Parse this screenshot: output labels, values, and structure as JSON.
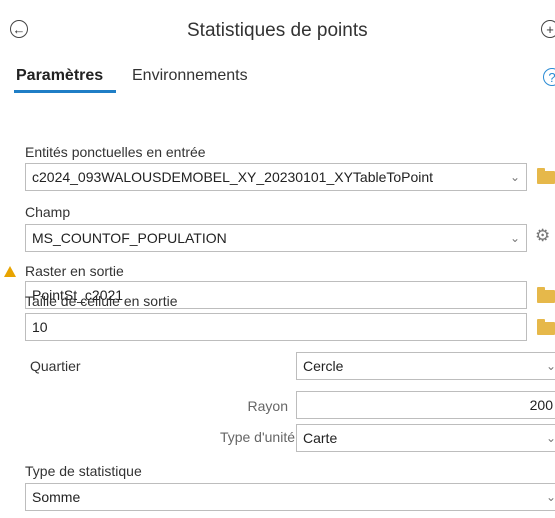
{
  "header": {
    "title": "Statistiques de points",
    "back_icon": "back-arrow-circle-icon",
    "add_icon": "plus-circle-icon"
  },
  "tabs": [
    {
      "label": "Paramètres",
      "active": true
    },
    {
      "label": "Environnements",
      "active": false
    }
  ],
  "help_icon": "help-circle-icon",
  "params": {
    "input_features": {
      "label": "Entités ponctuelles en entrée",
      "value": "c2024_093WALOUSDEMOBEL_XY_20230101_XYTableToPoint"
    },
    "field": {
      "label": "Champ",
      "value": "MS_COUNTOF_POPULATION"
    },
    "output_raster": {
      "label": "Raster en sortie",
      "value": "PointSt_c2021",
      "warning_icon": "warning-icon"
    },
    "cell_size": {
      "label": "Taille de cellule en sortie",
      "value": "10"
    },
    "neighborhood": {
      "label": "Quartier",
      "value": "Cercle"
    },
    "radius": {
      "label": "Rayon",
      "value": "200"
    },
    "unit_type": {
      "label": "Type d'unité",
      "value": "Carte"
    },
    "statistic_type": {
      "label": "Type de statistique",
      "value": "Somme"
    }
  },
  "colors": {
    "accent": "#1f7ec6",
    "folder": "#e6b84a",
    "warning": "#e8a400"
  }
}
